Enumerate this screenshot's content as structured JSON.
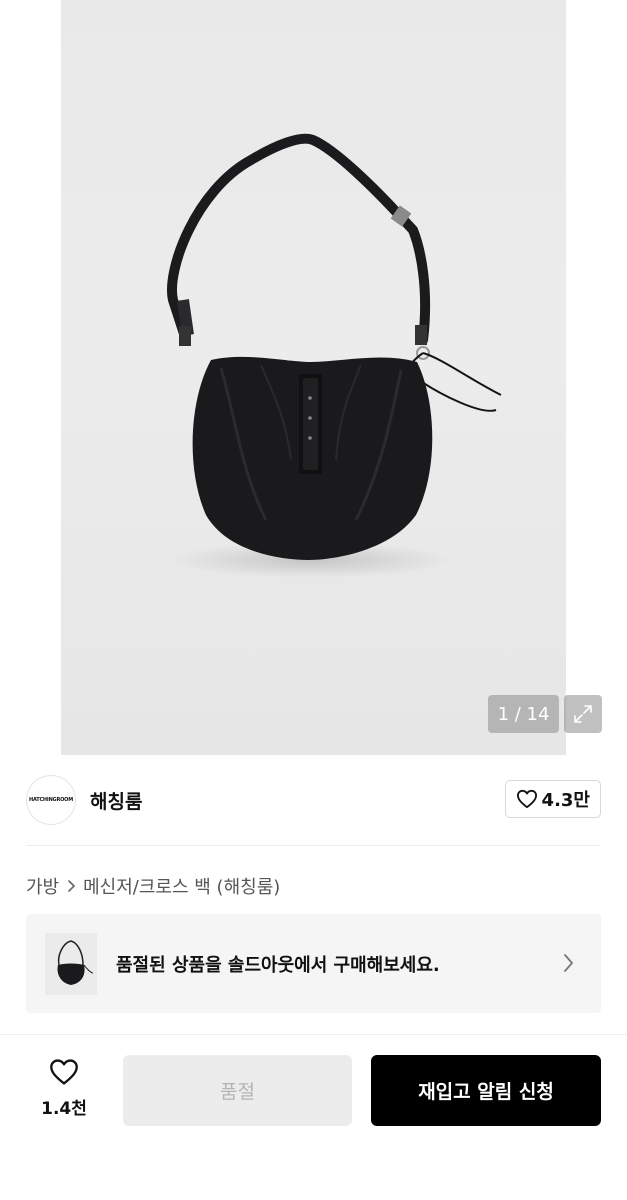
{
  "gallery": {
    "counter": "1 / 14",
    "expand_icon": "expand-icon"
  },
  "brand": {
    "logo_text": "HATCHINGROOM",
    "name": "해칭룸",
    "like_count": "4.3만"
  },
  "breadcrumb": {
    "category": "가방",
    "subcategory": "메신저/크로스 백 (해칭룸)"
  },
  "soldout_banner": {
    "text": "품절된 상품을 솔드아웃에서 구매해보세요."
  },
  "bottom_bar": {
    "wish_count": "1.4천",
    "soldout_label": "품절",
    "restock_label": "재입고 알림 신청"
  }
}
